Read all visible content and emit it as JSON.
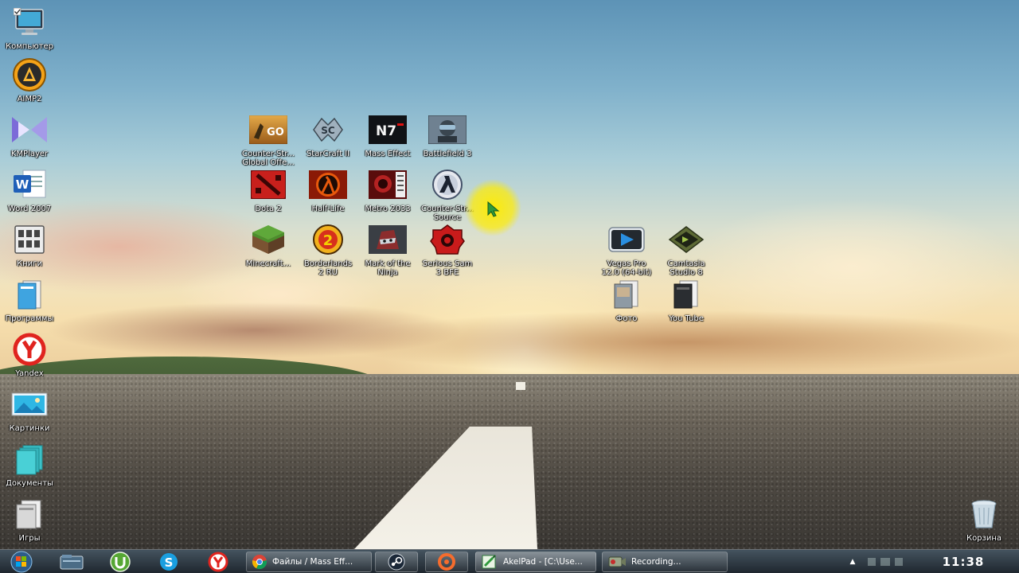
{
  "desktop": {
    "left_column": [
      {
        "label": "Компьютер",
        "icon": "computer-icon"
      },
      {
        "label": "AIMP2",
        "icon": "aimp-icon"
      },
      {
        "label": "KMPlayer",
        "icon": "kmplayer-icon"
      },
      {
        "label": "Word 2007",
        "icon": "word-icon"
      },
      {
        "label": "Книги",
        "icon": "books-icon"
      },
      {
        "label": "Программы",
        "icon": "programs-folder-icon"
      },
      {
        "label": "Yandex",
        "icon": "yandex-icon"
      },
      {
        "label": "Картинки",
        "icon": "pictures-icon"
      },
      {
        "label": "Документы",
        "icon": "documents-icon"
      },
      {
        "label": "Игры",
        "icon": "games-folder-icon"
      }
    ],
    "games": [
      {
        "label": "Counter-Str...\nGlobal Offe...",
        "icon": "csgo-icon"
      },
      {
        "label": "StarCraft II",
        "icon": "starcraft-icon"
      },
      {
        "label": "Mass Effect",
        "icon": "mass-effect-icon"
      },
      {
        "label": "Battlefield 3",
        "icon": "battlefield-icon"
      },
      {
        "label": "Dota 2",
        "icon": "dota-icon"
      },
      {
        "label": "Half-Life",
        "icon": "half-life-icon"
      },
      {
        "label": "Metro 2033",
        "icon": "metro-icon"
      },
      {
        "label": "Counter-Str...\nSource",
        "icon": "css-icon"
      },
      {
        "label": "Minecraft...",
        "icon": "minecraft-icon"
      },
      {
        "label": "Borderlands\n2 RU",
        "icon": "borderlands-icon"
      },
      {
        "label": "Mark of the\nNinja",
        "icon": "mark-ninja-icon"
      },
      {
        "label": "Serious Sam\n3 BFE",
        "icon": "serious-sam-icon"
      }
    ],
    "media": [
      {
        "label": "Vegas Pro\n12.0 (64-bit)",
        "icon": "vegas-icon"
      },
      {
        "label": "Camtasia\nStudio 8",
        "icon": "camtasia-icon"
      },
      {
        "label": "Фото",
        "icon": "photo-folder-icon"
      },
      {
        "label": "You Tube",
        "icon": "youtube-folder-icon"
      }
    ],
    "recycle_bin": {
      "label": "Корзина",
      "icon": "recycle-bin-icon"
    }
  },
  "taskbar": {
    "pinned": [
      "explorer-icon",
      "utorrent-icon",
      "skype-icon",
      "yandex-browser-icon"
    ],
    "tasks": [
      {
        "label": "Файлы / Mass Eff...",
        "icon": "chrome-icon"
      },
      {
        "label": "",
        "icon": "steam-icon"
      },
      {
        "label": "",
        "icon": "origin-icon"
      },
      {
        "label": "AkelPad - [C:\\Use...",
        "icon": "akelpad-icon"
      },
      {
        "label": "Recording...",
        "icon": "camtasia-recorder-icon"
      }
    ],
    "clock": "11:38"
  },
  "colors": {
    "sky": "#80b1cb",
    "horizon": "#f6dfae",
    "road": "#4f4a43",
    "taskbar": "#1d2830",
    "cursor_highlight": "#ffec00"
  }
}
